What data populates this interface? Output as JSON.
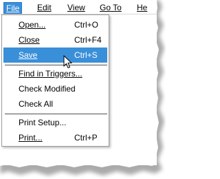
{
  "menubar": {
    "items": [
      {
        "label": "File",
        "active": true
      },
      {
        "label": "Edit",
        "active": false
      },
      {
        "label": "View",
        "active": false
      },
      {
        "label": "Go To",
        "active": false
      },
      {
        "label": "He",
        "active": false
      }
    ]
  },
  "file_menu": {
    "items": [
      {
        "label": "Open...",
        "shortcut": "Ctrl+O"
      },
      {
        "label": "Close",
        "shortcut": "Ctrl+F4"
      },
      {
        "label": "Save",
        "shortcut": "Ctrl+S",
        "highlighted": true
      },
      {
        "label": "Find in Triggers...",
        "shortcut": ""
      },
      {
        "label": "Check Modified",
        "shortcut": ""
      },
      {
        "label": "Check All",
        "shortcut": ""
      },
      {
        "label": "Print Setup...",
        "shortcut": ""
      },
      {
        "label": "Print...",
        "shortcut": "Ctrl+P"
      }
    ]
  },
  "colors": {
    "highlight": "#3a8fd9",
    "menu_border": "#9a9a9a",
    "separator": "#505050"
  },
  "icons": {
    "cursor": "mouse-pointer-icon"
  }
}
